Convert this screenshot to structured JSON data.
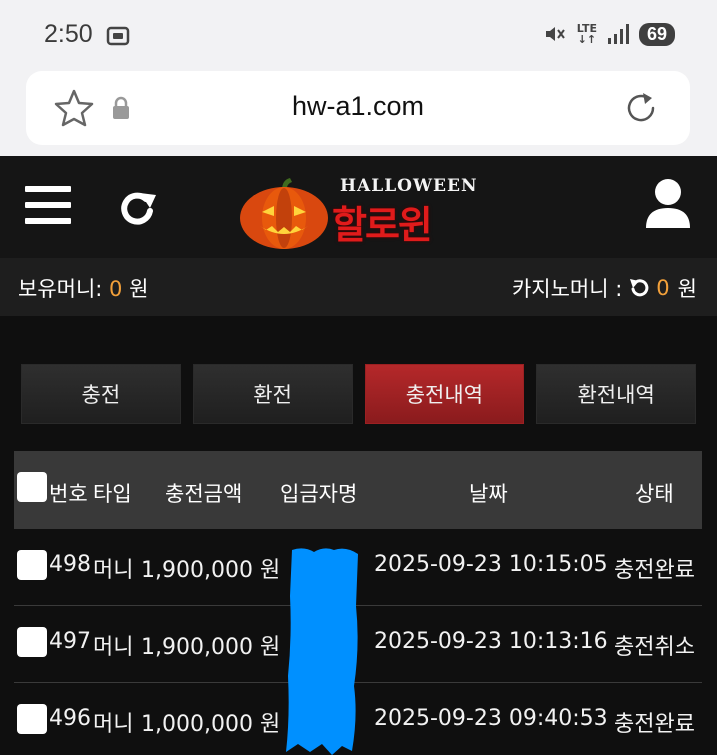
{
  "status_bar": {
    "time": "2:50",
    "network": "LTE",
    "battery": "69",
    "icons": [
      "screenshot-icon",
      "mute-icon",
      "lte-icon",
      "signal-icon",
      "battery-icon"
    ]
  },
  "browser": {
    "url": "hw-a1.com",
    "icons": [
      "star-icon",
      "lock-icon",
      "reload-icon"
    ]
  },
  "header": {
    "logo_en": "HALLOWEEN",
    "logo_ko": "할로윈",
    "icons": [
      "menu-icon",
      "refresh-icon",
      "pumpkin-logo",
      "user-icon"
    ]
  },
  "money": {
    "held_label": "보유머니:",
    "held_value": "0",
    "currency": "원",
    "casino_label": "카지노머니 :",
    "casino_value": "0",
    "casino_currency": "원"
  },
  "tabs": [
    {
      "label": "충전",
      "active": false
    },
    {
      "label": "환전",
      "active": false
    },
    {
      "label": "충전내역",
      "active": true
    },
    {
      "label": "환전내역",
      "active": false
    }
  ],
  "table": {
    "headers": {
      "number": "번호",
      "type": "타입",
      "amount": "충전금액",
      "depositor": "입금자명",
      "date": "날짜",
      "status": "상태"
    },
    "rows": [
      {
        "number": "498",
        "type": "머니",
        "amount": "1,900,000 원",
        "depositor": "",
        "date": "2025-09-23 10:15:05",
        "status": "충전완료"
      },
      {
        "number": "497",
        "type": "머니",
        "amount": "1,900,000 원",
        "depositor": "",
        "date": "2025-09-23 10:13:16",
        "status": "충전취소"
      },
      {
        "number": "496",
        "type": "머니",
        "amount": "1,000,000 원",
        "depositor": "",
        "date": "2025-09-23 09:40:53",
        "status": "충전완료"
      }
    ]
  },
  "colors": {
    "accent_orange": "#f2a03a",
    "active_tab": "#a52224",
    "redaction": "#0090ff"
  }
}
